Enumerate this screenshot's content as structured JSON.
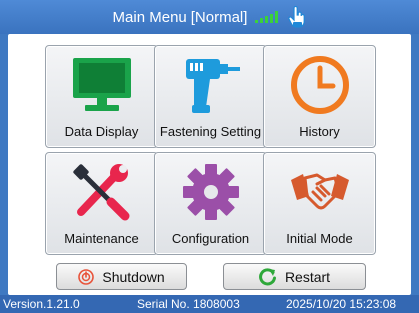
{
  "title_bar": {
    "title": "Main Menu",
    "mode": "[Normal]",
    "signal_color": "#3bd13b"
  },
  "menu": {
    "data_display": "Data Display",
    "fastening_setting": "Fastening Setting",
    "history": "History",
    "maintenance": "Maintenance",
    "configuration": "Configuration",
    "initial_mode": "Initial Mode"
  },
  "icons": {
    "data_display": "monitor-icon",
    "fastening_setting": "power-tool-icon",
    "history": "clock-icon",
    "maintenance": "tools-icon",
    "configuration": "gear-icon",
    "initial_mode": "handshake-icon"
  },
  "buttons": {
    "shutdown": "Shutdown",
    "restart": "Restart"
  },
  "status_bar": {
    "version": "Version.1.21.0",
    "serial": "Serial No. 1808003",
    "datetime": "2025/10/20 15:23:08"
  },
  "colors": {
    "title_bar": "#3f79c2",
    "status_bar": "#3468b3",
    "monitor": "#1aa34a",
    "tool": "#1e9bdc",
    "clock": "#f07a20",
    "tools_red": "#e8264d",
    "gear": "#9b4fa8",
    "handshake": "#d65a2e"
  }
}
